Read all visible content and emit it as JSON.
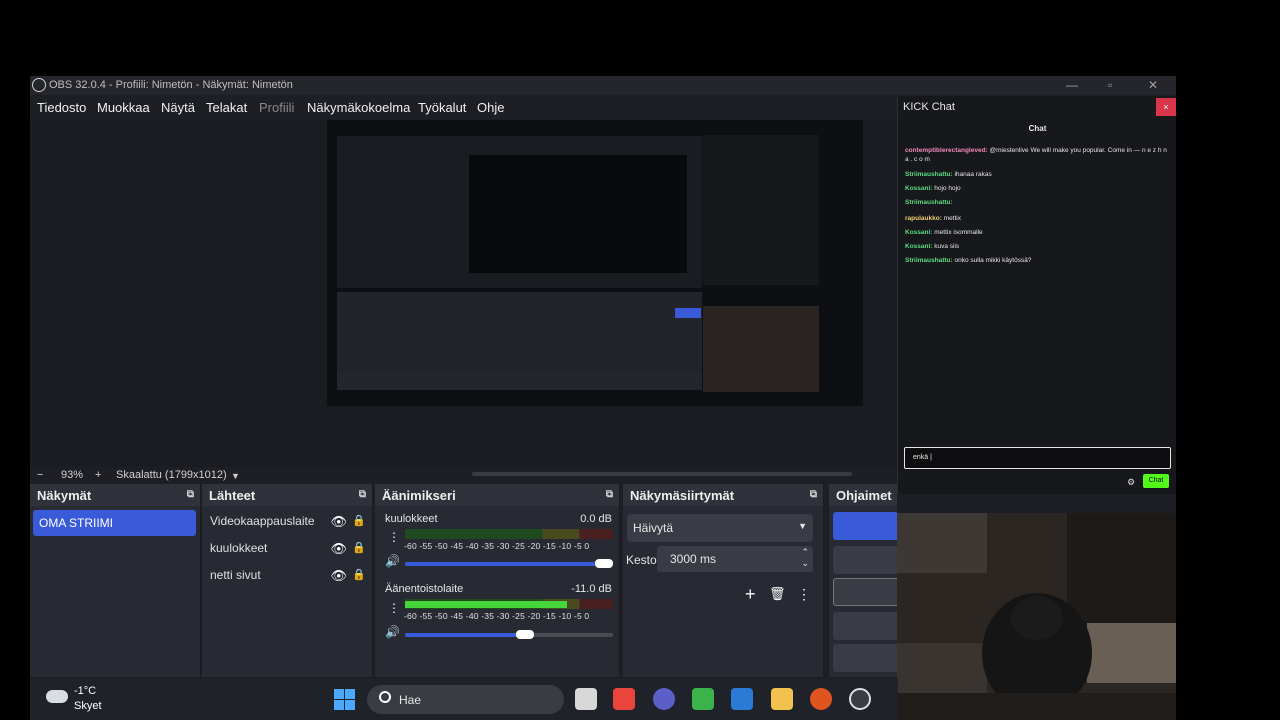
{
  "window": {
    "title": "OBS 32.0.4 - Profiili: Nimetön - Näkymät: Nimetön",
    "minimize": "—",
    "maximize": "▫",
    "close": "✕"
  },
  "menu": [
    "Tiedosto",
    "Muokkaa",
    "Näytä",
    "Telakat",
    "Profiili",
    "Näkymäkokoelma",
    "Työkalut",
    "Ohje"
  ],
  "zoom": {
    "minus": "−",
    "value": "93%",
    "plus": "+",
    "mode": "Skaalattu (1799x1012)",
    "dropdown": "▼"
  },
  "scenes": {
    "header": "Näkymät",
    "items": [
      "OMA STRIIMI"
    ]
  },
  "sources": {
    "header": "Lähteet",
    "items": [
      "Videokaappauslaite",
      "kuulokkeet",
      "netti sivut"
    ]
  },
  "mixer": {
    "header": "Äänimikseri",
    "scale": "-60 -55 -50 -45 -40 -35 -30 -25 -20 -15 -10  -5   0",
    "channels": [
      {
        "name": "kuulokkeet",
        "db": "0.0 dB",
        "level": 0.0,
        "volume": 1.0
      },
      {
        "name": "Äänentoistolaite",
        "db": "-11.0 dB",
        "level": 0.78,
        "volume": 0.62
      }
    ]
  },
  "transitions": {
    "header": "Näkymäsiirtymät",
    "selected": "Häivytä",
    "duration_label": "Kesto",
    "duration_value": "3000 ms"
  },
  "controls": {
    "header": "Ohjaimet"
  },
  "chat": {
    "title": "KICK Chat",
    "close": "×",
    "header": "Chat",
    "messages": [
      {
        "user": "contemptiblerectangleved:",
        "text": " @miestenlive We will make you popular. Come in — n e z h n a . c o m",
        "color": "#f08ab8"
      },
      {
        "user": "Striimaushattu:",
        "text": " ihanaa rakas",
        "color": "#5ddc7f"
      },
      {
        "user": "Kossani:",
        "text": " hojo hojo",
        "color": "#5ddc7f"
      },
      {
        "user": "Striimaushattu:",
        "text": "",
        "color": "#5ddc7f"
      },
      {
        "user": "rapulaukko:",
        "text": " mettix",
        "color": "#f0d070"
      },
      {
        "user": "Kossani:",
        "text": " mettix isommalle",
        "color": "#5ddc7f"
      },
      {
        "user": "Kossani:",
        "text": " kuva siis",
        "color": "#5ddc7f"
      },
      {
        "user": "Striimaushattu:",
        "text": " onko sulla mikki käytössä?",
        "color": "#5ddc7f"
      }
    ],
    "input_value": "enkä |",
    "send_label": "Chat"
  },
  "taskbar": {
    "temperature": "-1°C",
    "condition": "Skyet",
    "search_placeholder": "Hae"
  },
  "colors": {
    "accent": "#3a5bd9",
    "kick_green": "#53fc18",
    "close_red": "#d9364b"
  }
}
